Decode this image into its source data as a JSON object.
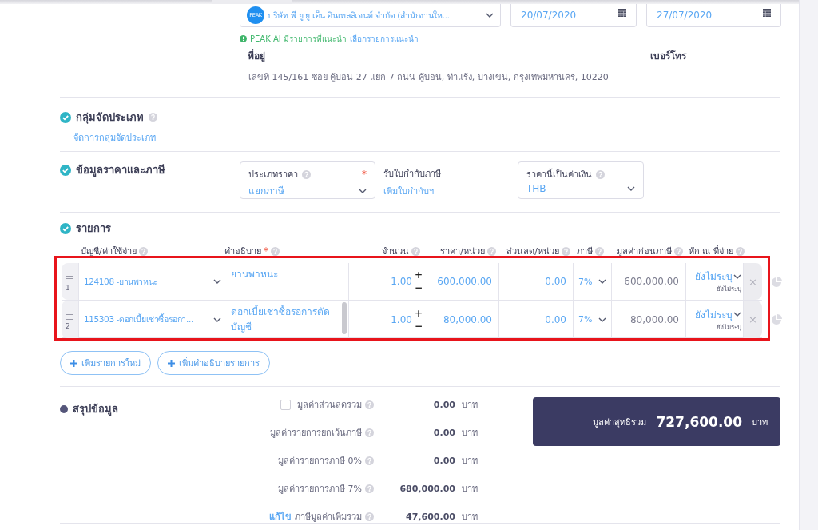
{
  "vendor": {
    "logo": "PEAK",
    "value": "บริษัท พี ยู ยู เอ็น อินเทลลิเจนท์ จำกัด (สำนักงานให...",
    "issue_date": "20/07/2020",
    "due_date": "27/07/2020",
    "ai_notice": "PEAK AI มีรายการที่แนะนำ",
    "ai_link": "เลือกรายการแนะนำ",
    "address_label": "ที่อยู่",
    "address": "เลขที่ 145/161 ซอย คู้บอน 27 แยก 7 ถนน คู้บอน, ท่าแร้ง, บางเขน, กรุงเทพมหานคร, 10220",
    "phone_label": "เบอร์โทร"
  },
  "category": {
    "title": "กลุ่มจัดประเภท",
    "checked": true,
    "link": "จัดการกลุ่มจัดประเภท"
  },
  "pricing": {
    "title": "ข้อมูลราคาและภาษี",
    "checked": true,
    "price_type": {
      "label": "ประเภทราคา",
      "required_mark": "*",
      "value": "แยกภาษี"
    },
    "tax_invoice": {
      "label": "รับใบกำกับภาษี",
      "link": "เพิ่มใบกำกับฯ"
    },
    "currency": {
      "label": "ราคานี้เป็นค่าเงิน",
      "value": "THB"
    }
  },
  "items": {
    "title": "รายการ",
    "checked": true,
    "highlighted": true,
    "columns": [
      {
        "label": "บัญชี/ค่าใช้จ่าย"
      },
      {
        "label": "คำอธิบาย",
        "required_mark": "*"
      },
      {
        "label": "จำนวน"
      },
      {
        "label": "ราคา/หน่วย"
      },
      {
        "label": "ส่วนลด/หน่วย"
      },
      {
        "label": "ภาษี"
      },
      {
        "label": "มูลค่าก่อนภาษี"
      },
      {
        "label": "หัก ณ ที่จ่าย"
      }
    ],
    "rows": [
      {
        "number": "1",
        "account": "124108 -ยานพาหนะ",
        "description": "ยานพาหนะ",
        "scrollbar": false,
        "quantity": "1.00",
        "plus": "+",
        "minus": "−",
        "price": "600,000.00",
        "discount": "0.00",
        "vat": "7%",
        "pretax": "600,000.00",
        "wht": "ยังไม่ระบุ",
        "wht_note": "ยังไม่ระบุ",
        "remove": "×"
      },
      {
        "number": "2",
        "account": "115303 -ดอกเบี้ยเช่าซื้อรอกา...",
        "description": "ดอกเบี้ยเช่าซื้อรอการตัดบัญชี",
        "scrollbar": true,
        "quantity": "1.00",
        "plus": "+",
        "minus": "−",
        "price": "80,000.00",
        "discount": "0.00",
        "vat": "7%",
        "pretax": "80,000.00",
        "wht": "ยังไม่ระบุ",
        "wht_note": "ยังไม่ระบุ",
        "remove": "×"
      }
    ],
    "buttons": [
      "เพิ่มรายการใหม่",
      "เพิ่มคำอธิบายรายการ"
    ]
  },
  "summary": {
    "title": "สรุปข้อมูล",
    "checked": false,
    "lines": [
      {
        "kind": "checkbox",
        "checked": false,
        "label": "มูลค่าส่วนลดรวม",
        "value": "0.00",
        "unit": "บาท"
      },
      {
        "kind": "plain",
        "label": "มูลค่ารายการยกเว้นภาษี",
        "value": "0.00",
        "unit": "บาท"
      },
      {
        "kind": "plain",
        "label": "มูลค่ารายการภาษี 0%",
        "value": "0.00",
        "unit": "บาท"
      },
      {
        "kind": "plain",
        "label": "มูลค่ารายการภาษี 7%",
        "value": "680,000.00",
        "unit": "บาท"
      },
      {
        "kind": "edit",
        "link": "แก้ไข",
        "label": "ภาษีมูลค่าเพิ่มรวม",
        "value": "47,600.00",
        "unit": "บาท"
      }
    ],
    "total": {
      "label": "มูลค่าสุทธิรวม",
      "value": "727,600.00",
      "unit": "บาท"
    }
  }
}
